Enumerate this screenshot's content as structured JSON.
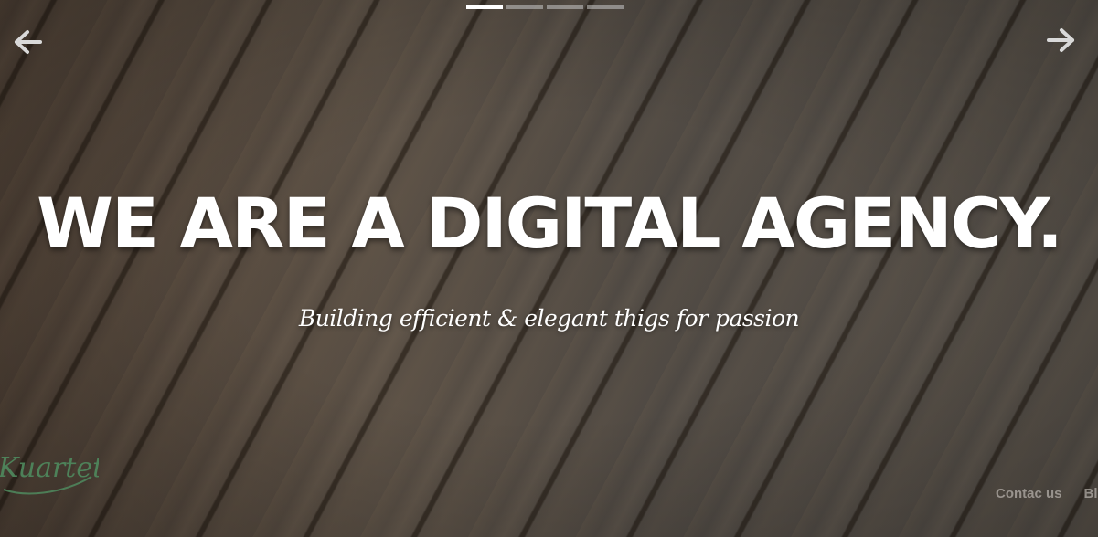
{
  "carousel": {
    "indicators": [
      {
        "active": true
      },
      {
        "active": false
      },
      {
        "active": false
      },
      {
        "active": false
      }
    ],
    "prev_icon": "arrow-left-icon",
    "next_icon": "arrow-right-icon"
  },
  "hero": {
    "headline": "WE ARE A DIGITAL AGENCY.",
    "tagline": "Building efficient & elegant thigs for passion"
  },
  "logo": {
    "text": "Kuartett",
    "color": "#4f8a5e"
  },
  "nav": {
    "items": [
      {
        "label": "Contac us"
      },
      {
        "label": "Blo"
      }
    ]
  },
  "colors": {
    "text": "#ffffff",
    "indicator_active": "#ffffff",
    "indicator_inactive": "#b4b4b4",
    "nav_text": "#bdb7b1"
  }
}
